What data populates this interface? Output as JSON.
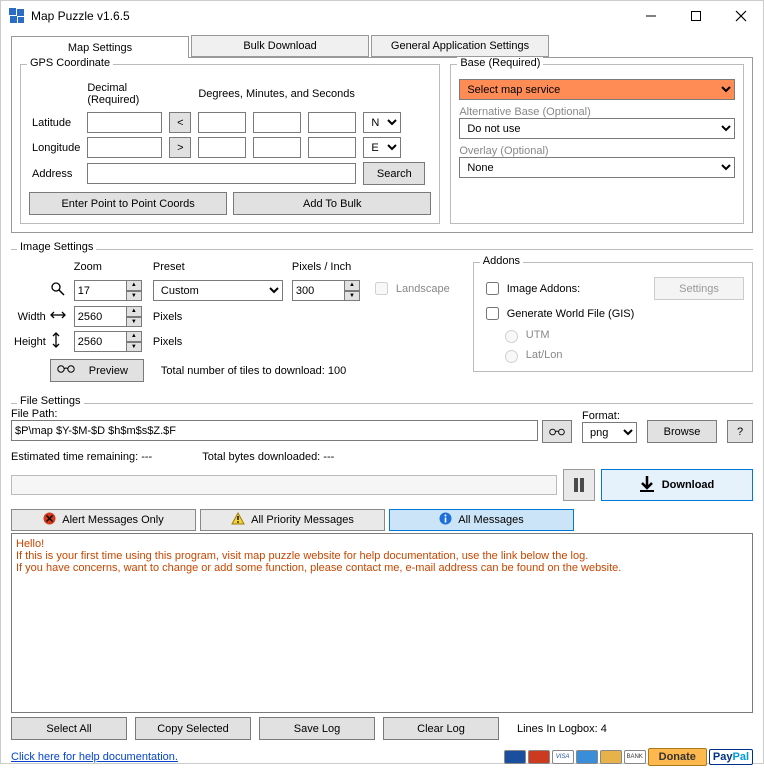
{
  "window": {
    "title": "Map Puzzle v1.6.5"
  },
  "tabs": {
    "map_settings": "Map Settings",
    "bulk_download": "Bulk Download",
    "general_settings": "General Application Settings"
  },
  "gps": {
    "legend": "GPS Coordinate",
    "decimal_hdr": "Decimal (Required)",
    "dms_hdr": "Degrees, Minutes, and Seconds",
    "latitude_lbl": "Latitude",
    "longitude_lbl": "Longitude",
    "address_lbl": "Address",
    "search_btn": "Search",
    "point_btn": "Enter Point to Point Coords",
    "bulk_btn": "Add To Bulk",
    "swap_lt": "<",
    "swap_lg": ">",
    "ns": "N",
    "ew": "E"
  },
  "base": {
    "required_lbl": "Base (Required)",
    "select_service": "Select map service",
    "alt_lbl": "Alternative Base (Optional)",
    "alt_value": "Do not use",
    "overlay_lbl": "Overlay (Optional)",
    "overlay_value": "None"
  },
  "image": {
    "legend": "Image Settings",
    "zoom_lbl": "Zoom",
    "zoom_val": "17",
    "preset_lbl": "Preset",
    "preset_val": "Custom",
    "ppi_lbl": "Pixels / Inch",
    "ppi_val": "300",
    "landscape_lbl": "Landscape",
    "width_lbl": "Width",
    "width_val": "2560",
    "pixels_lbl": "Pixels",
    "height_lbl": "Height",
    "height_val": "2560",
    "preview_btn": "Preview",
    "tiles_text": "Total number of tiles to download: 100"
  },
  "addons": {
    "legend": "Addons",
    "image_addons": "Image Addons:",
    "settings_btn": "Settings",
    "gen_world": "Generate World File (GIS)",
    "utm": "UTM",
    "latlon": "Lat/Lon"
  },
  "file": {
    "legend": "File Settings",
    "path_lbl": "File Path:",
    "path_val": "$P\\map $Y-$M-$D $h$m$s$Z.$F",
    "format_lbl": "Format:",
    "format_val": "png",
    "browse_btn": "Browse",
    "q_btn": "?"
  },
  "progress": {
    "est_lbl": "Estimated time remaining: ---",
    "bytes_lbl": "Total bytes downloaded: ---",
    "download_btn": "Download"
  },
  "msgtabs": {
    "alert": "Alert Messages Only",
    "priority": "All Priority Messages",
    "all": "All Messages"
  },
  "log": {
    "line1": "Hello!",
    "line2": "If this is your first time using this program, visit map puzzle website for help documentation, use the link below the log.",
    "line3": "If you have concerns, want to change or add some function, please contact me, e-mail address can be found on the website.",
    "select_all": "Select All",
    "copy": "Copy Selected",
    "save": "Save Log",
    "clear": "Clear Log",
    "lines_lbl": "Lines In Logbox: 4"
  },
  "footer": {
    "help_link": "Click here for help documentation.",
    "donate": "Donate"
  }
}
